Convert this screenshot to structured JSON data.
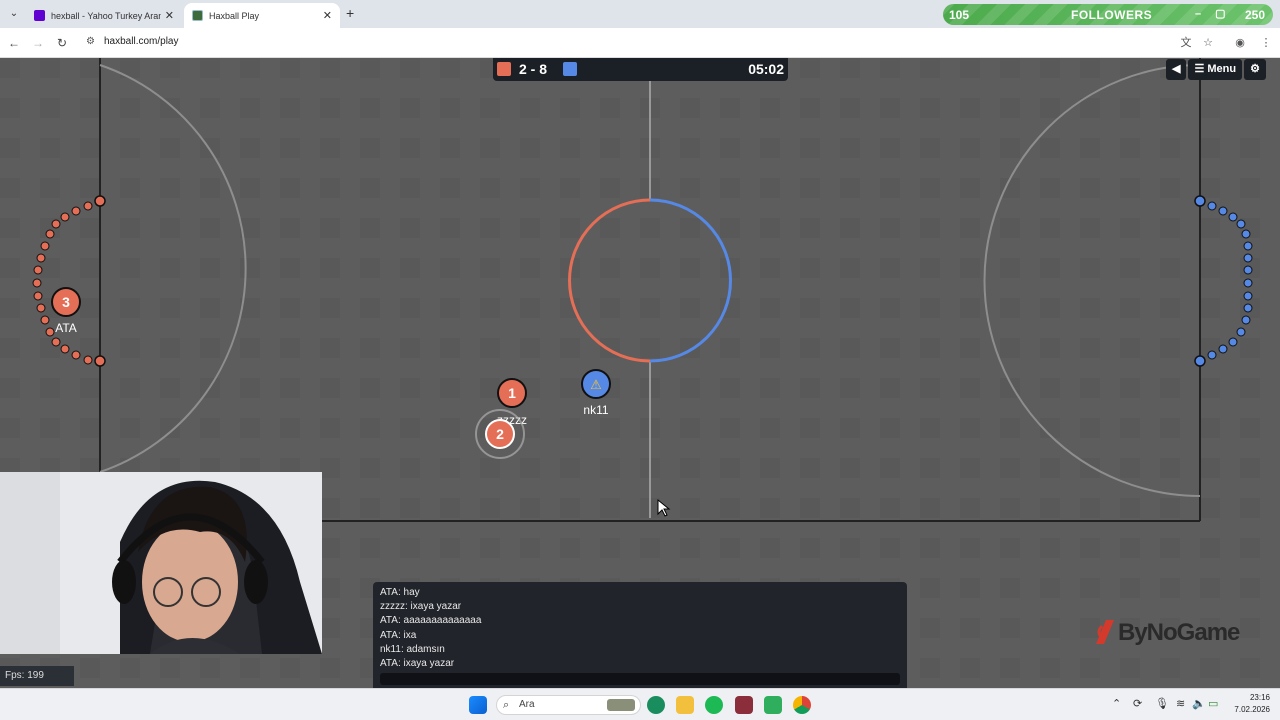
{
  "browser": {
    "tabs": [
      {
        "title": "hexball - Yahoo Turkey Arama S",
        "active": false
      },
      {
        "title": "Haxball Play",
        "active": true
      }
    ],
    "url": "haxball.com/play"
  },
  "overlay": {
    "followers_current": "105",
    "followers_label": "FOLLOWERS",
    "followers_goal": "250",
    "brand_logo_text": "ByNoGame"
  },
  "game": {
    "red_score": "2",
    "separator": "-",
    "blue_score": "8",
    "score_text": "2 - 8",
    "time": "05:02",
    "menu_label": "Menu",
    "fps_label": "Fps: 199",
    "colors": {
      "red": "#e56e56",
      "blue": "#5689e5",
      "pitch": "#5b5b5b",
      "line": "#c7e6bd"
    },
    "players": [
      {
        "number": "1",
        "name": "zzzzz",
        "team": "red"
      },
      {
        "number": "2",
        "name": "",
        "team": "red"
      },
      {
        "number": "3",
        "name": "ATA",
        "team": "red"
      },
      {
        "number": "⚠",
        "name": "nk11",
        "team": "blue"
      }
    ]
  },
  "chat": {
    "messages": [
      "ATA: hay",
      "zzzzz: ixaya yazar",
      "ATA: aaaaaaaaaaaaaa",
      "ATA: ixa",
      "nk11: adamsın",
      "ATA: ixaya yazar"
    ]
  },
  "taskbar": {
    "search_placeholder": "Ara",
    "time": "23:16",
    "date": "7.02.2026"
  }
}
